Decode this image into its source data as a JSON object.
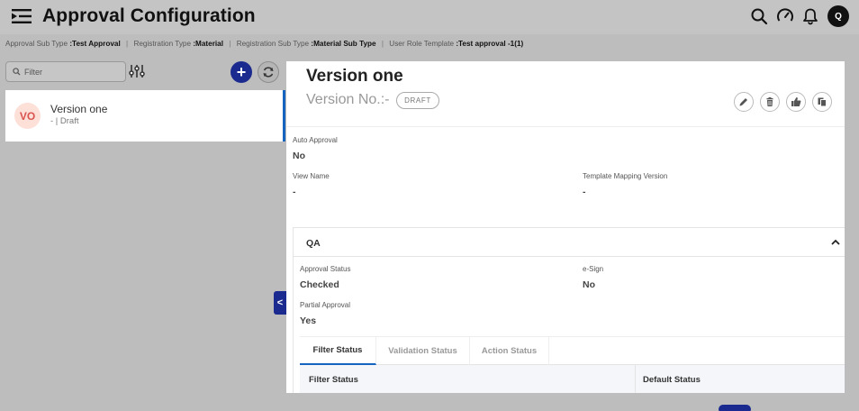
{
  "header": {
    "title": "Approval Configuration",
    "menu_icon": "sidebar-toggle-icon",
    "icons": [
      "search-icon",
      "speedometer-icon",
      "bell-icon"
    ],
    "avatar": "Q"
  },
  "breadcrumb": {
    "items": [
      {
        "label": "Approval Sub Type",
        "value": ":Test Approval"
      },
      {
        "label": "Registration Type",
        "value": ":Material"
      },
      {
        "label": "Registration Sub Type",
        "value": ":Material Sub Type"
      },
      {
        "label": "User Role Template",
        "value": ":Test approval -1(1)"
      }
    ],
    "separator": "|"
  },
  "left": {
    "filter_placeholder": "Filter",
    "add_label": "+",
    "versions": [
      {
        "initials": "VO",
        "title": "Version one",
        "subtitle": "- | Draft",
        "selected": true
      }
    ],
    "collapse_label": "<"
  },
  "detail": {
    "title": "Version one",
    "version_label": "Version No.:-",
    "status_badge": "DRAFT",
    "actions": [
      "edit-icon",
      "delete-icon",
      "thumbs-up-icon",
      "copy-icon"
    ],
    "fields": {
      "auto_approval": {
        "label": "Auto Approval",
        "value": "No"
      },
      "view_name": {
        "label": "View Name",
        "value": "-"
      },
      "template_mapping_version": {
        "label": "Template Mapping Version",
        "value": "-"
      }
    },
    "qa": {
      "title": "QA",
      "approval_status": {
        "label": "Approval Status",
        "value": "Checked"
      },
      "esign": {
        "label": "e-Sign",
        "value": "No"
      },
      "partial_approval": {
        "label": "Partial Approval",
        "value": "Yes"
      },
      "tabs": [
        {
          "label": "Filter Status",
          "active": true
        },
        {
          "label": "Validation Status",
          "active": false
        },
        {
          "label": "Action Status",
          "active": false
        }
      ],
      "table_headers": [
        "Filter Status",
        "Default Status"
      ]
    }
  },
  "colors": {
    "accent": "#1565c0",
    "primary_button": "#1a2a8f",
    "avatar_bg": "#fde0d8",
    "avatar_text": "#d9534f"
  }
}
